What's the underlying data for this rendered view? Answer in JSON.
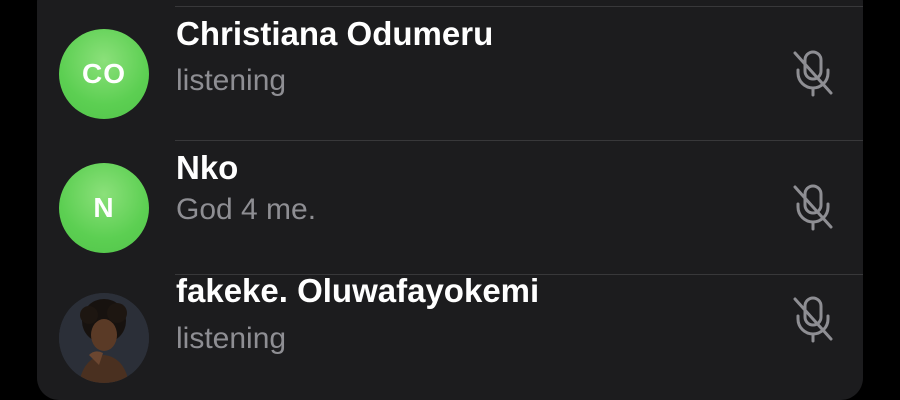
{
  "participants": [
    {
      "initials": "CO",
      "name": "Christiana Odumeru",
      "status": "listening",
      "avatar_type": "initials",
      "avatar_color": "#5ccf52",
      "mic_icon": "mic-muted-icon"
    },
    {
      "initials": "N",
      "name": "Nko",
      "status": "God 4 me.",
      "avatar_type": "initials",
      "avatar_color": "#5ccf52",
      "mic_icon": "mic-muted-icon"
    },
    {
      "initials": "",
      "name": "fakeke. Oluwafayokemi",
      "status": "listening",
      "avatar_type": "photo",
      "mic_icon": "mic-muted-icon"
    }
  ],
  "colors": {
    "background": "#000000",
    "panel": "#1c1c1e",
    "divider": "#38383a",
    "name_text": "#ffffff",
    "status_text": "#8e8e93",
    "mic_icon": "#8e8e93"
  }
}
